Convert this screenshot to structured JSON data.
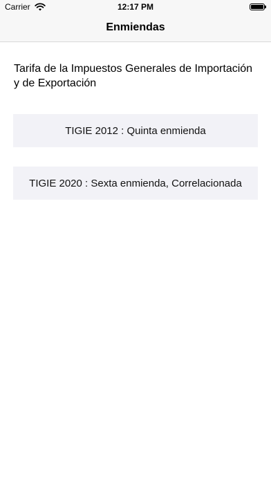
{
  "status_bar": {
    "carrier": "Carrier",
    "time": "12:17 PM",
    "icons": [
      "wifi-icon",
      "battery-icon"
    ]
  },
  "nav": {
    "title": "Enmiendas"
  },
  "main": {
    "intro": "Tarifa de la  Impuestos Generales de Importación y de Exportación",
    "buttons": [
      {
        "label": "TIGIE 2012 : Quinta enmienda"
      },
      {
        "label": "TIGIE 2020 : Sexta enmienda, Correlacionada"
      }
    ]
  },
  "colors": {
    "background": "#ffffff",
    "bar_background": "#f7f7f7",
    "button_background": "#f2f2f7"
  }
}
